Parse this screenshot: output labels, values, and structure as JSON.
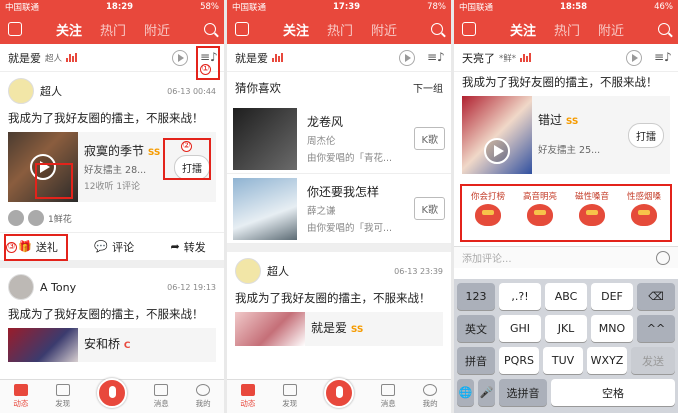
{
  "accent": "#e8483c",
  "highlight": "#e3231b",
  "phones": [
    {
      "status": {
        "carrier": "中国联通",
        "time": "18:29",
        "battery": "58%"
      },
      "nav": {
        "tabs": [
          "关注",
          "热门",
          "附近"
        ]
      },
      "now_playing": {
        "title": "就是爱",
        "sub": "超人"
      },
      "post1": {
        "user": "超人",
        "time": "06-13 00:44",
        "text": "我成为了我好友圈的擂主，不服来战！",
        "song": {
          "title": "寂寞的季节",
          "badge": "SS",
          "desc": "好友擂主 28...",
          "stats": "12收听 1评论"
        },
        "hit_label": "打擂",
        "gifts": "1鲜花",
        "actions": [
          "送礼",
          "评论",
          "转发"
        ]
      },
      "post2": {
        "user": "A Tony",
        "time": "06-12 19:13",
        "text": "我成为了我好友圈的擂主，不服来战！",
        "song": {
          "title": "安和桥",
          "badge": "C"
        }
      },
      "annotations": [
        "①",
        "②",
        "③"
      ],
      "tabbar": [
        "动态",
        "发现",
        "",
        "消息",
        "我的"
      ]
    },
    {
      "status": {
        "carrier": "中国联通",
        "time": "17:39",
        "battery": "78%"
      },
      "nav": {
        "tabs": [
          "关注",
          "热门",
          "附近"
        ]
      },
      "now_playing": {
        "title": "就是爱",
        "sub": ""
      },
      "reco_title": "猜你喜欢",
      "reco_next": "下一组",
      "recos": [
        {
          "title": "龙卷风",
          "artist": "周杰伦",
          "desc": "由你爱唱的「青花...",
          "btn": "K歌"
        },
        {
          "title": "你还要我怎样",
          "artist": "薛之谦",
          "desc": "由你爱唱的「我可...",
          "btn": "K歌"
        }
      ],
      "post": {
        "user": "超人",
        "time": "06-13 23:39",
        "text": "我成为了我好友圈的擂主，不服来战！",
        "song": {
          "title": "就是爱",
          "badge": "SS"
        }
      },
      "tabbar": [
        "动态",
        "发现",
        "",
        "消息",
        "我的"
      ]
    },
    {
      "status": {
        "carrier": "中国联通",
        "time": "18:58",
        "battery": "46%"
      },
      "nav": {
        "tabs": [
          "关注",
          "热门",
          "附近"
        ]
      },
      "now_playing": {
        "title": "天亮了",
        "sub": "*鲜*"
      },
      "post": {
        "text": "我成为了我好友圈的擂主，不服来战！",
        "song": {
          "title": "错过",
          "badge": "SS",
          "desc": "好友擂主 25..."
        },
        "hit_label": "打擂"
      },
      "stickers": [
        "你会打榜",
        "高音明亮",
        "磁性嗓音",
        "性感烟嗓"
      ],
      "comment_placeholder": "添加评论...",
      "keyboard": {
        "row1": [
          "123",
          ",.?!",
          "ABC",
          "DEF",
          "⌫"
        ],
        "row2": [
          "英文",
          "GHI",
          "JKL",
          "MNO",
          "^^"
        ],
        "row3": [
          "拼音",
          "PQRS",
          "TUV",
          "WXYZ",
          "发送"
        ],
        "row4": [
          "🌐",
          "🎤",
          "选拼音",
          "空格"
        ]
      }
    }
  ]
}
